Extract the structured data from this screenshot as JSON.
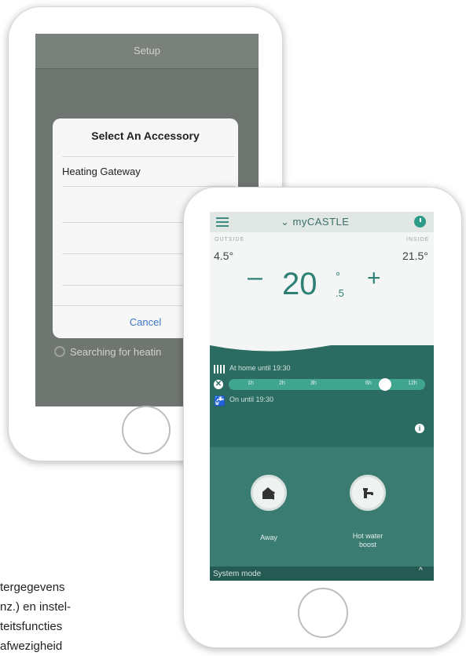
{
  "back_phone": {
    "nav_title": "Setup",
    "dialog": {
      "title": "Select An Accessory",
      "item": "Heating Gateway",
      "cancel": "Cancel"
    },
    "status": "Searching for heatin"
  },
  "front_phone": {
    "app_title": "myCASTLE",
    "outside_label": "OUTSIDE",
    "inside_label": "INSIDE",
    "outside_temp": "4.5°",
    "inside_temp": "21.5°",
    "minus": "–",
    "plus": "+",
    "setpoint_whole": "20",
    "setpoint_degree": "°",
    "setpoint_decimal": ".5",
    "heating_schedule": "At home until 19:30",
    "boost_ticks": [
      "1h",
      "2h",
      "3h",
      "6h",
      "12h"
    ],
    "hot_water_status": "On until 19:30",
    "cancel_symbol": "✕",
    "info_symbol": "i",
    "actions": {
      "away": "Away",
      "hot_water_line1": "Hot water",
      "hot_water_line2": "boost"
    },
    "system_mode": "System mode",
    "chevron": "^"
  },
  "caption_lines": [
    "tergegevens",
    "nz.) en instel-",
    "teitsfuncties",
    "afwezigheid"
  ],
  "colors": {
    "accent": "#2e7f74",
    "panel_dark": "#2b6b61",
    "slider": "#3fa58f"
  }
}
